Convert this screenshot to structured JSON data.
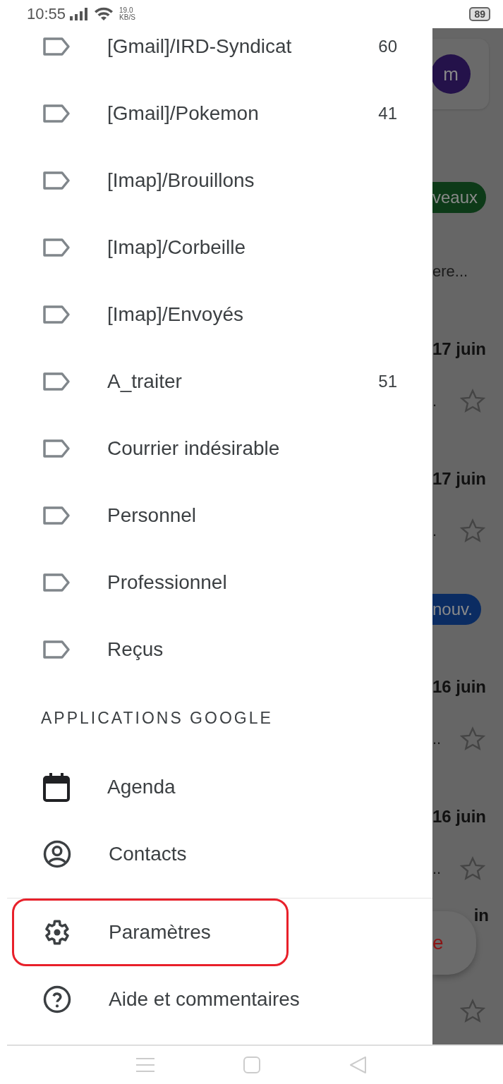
{
  "status_bar": {
    "time": "10:55",
    "speed_value": "19.0",
    "speed_unit": "KB/S",
    "battery": "89"
  },
  "drawer": {
    "labels": [
      {
        "name": "[Gmail]/IRD-Syndicat",
        "count": "60"
      },
      {
        "name": "[Gmail]/Pokemon",
        "count": "41"
      },
      {
        "name": "[Imap]/Brouillons"
      },
      {
        "name": "[Imap]/Corbeille"
      },
      {
        "name": "[Imap]/Envoyés"
      },
      {
        "name": "A_traiter",
        "count": "51"
      },
      {
        "name": "Courrier indésirable"
      },
      {
        "name": "Personnel"
      },
      {
        "name": "Professionnel"
      },
      {
        "name": "Reçus"
      }
    ],
    "section_title": "APPLICATIONS GOOGLE",
    "apps": [
      {
        "kind": "calendar",
        "label": "Agenda"
      },
      {
        "kind": "contacts",
        "label": "Contacts"
      }
    ],
    "footer_items": [
      {
        "kind": "settings",
        "label": "Paramètres",
        "highlighted": true
      },
      {
        "kind": "help",
        "label": "Aide et commentaires",
        "highlighted": false
      }
    ]
  },
  "background": [
    {
      "kind": "card",
      "text": "m"
    },
    {
      "kind": "chip",
      "text": "veaux",
      "color": "#0d3a18"
    },
    {
      "kind": "snippet",
      "text": "ere..."
    },
    {
      "kind": "date",
      "text": "17 juin"
    },
    {
      "kind": "star",
      "text": "."
    },
    {
      "kind": "date",
      "text": "17 juin"
    },
    {
      "kind": "star",
      "text": "."
    },
    {
      "kind": "chip",
      "text": "nouv.",
      "color": "#0b2c62"
    },
    {
      "kind": "date",
      "text": "16 juin"
    },
    {
      "kind": "star",
      "text": ".."
    },
    {
      "kind": "date",
      "text": "16 juin"
    },
    {
      "kind": "star",
      "text": ".."
    },
    {
      "kind": "fab",
      "text": "e",
      "date": "in"
    },
    {
      "kind": "star"
    }
  ]
}
